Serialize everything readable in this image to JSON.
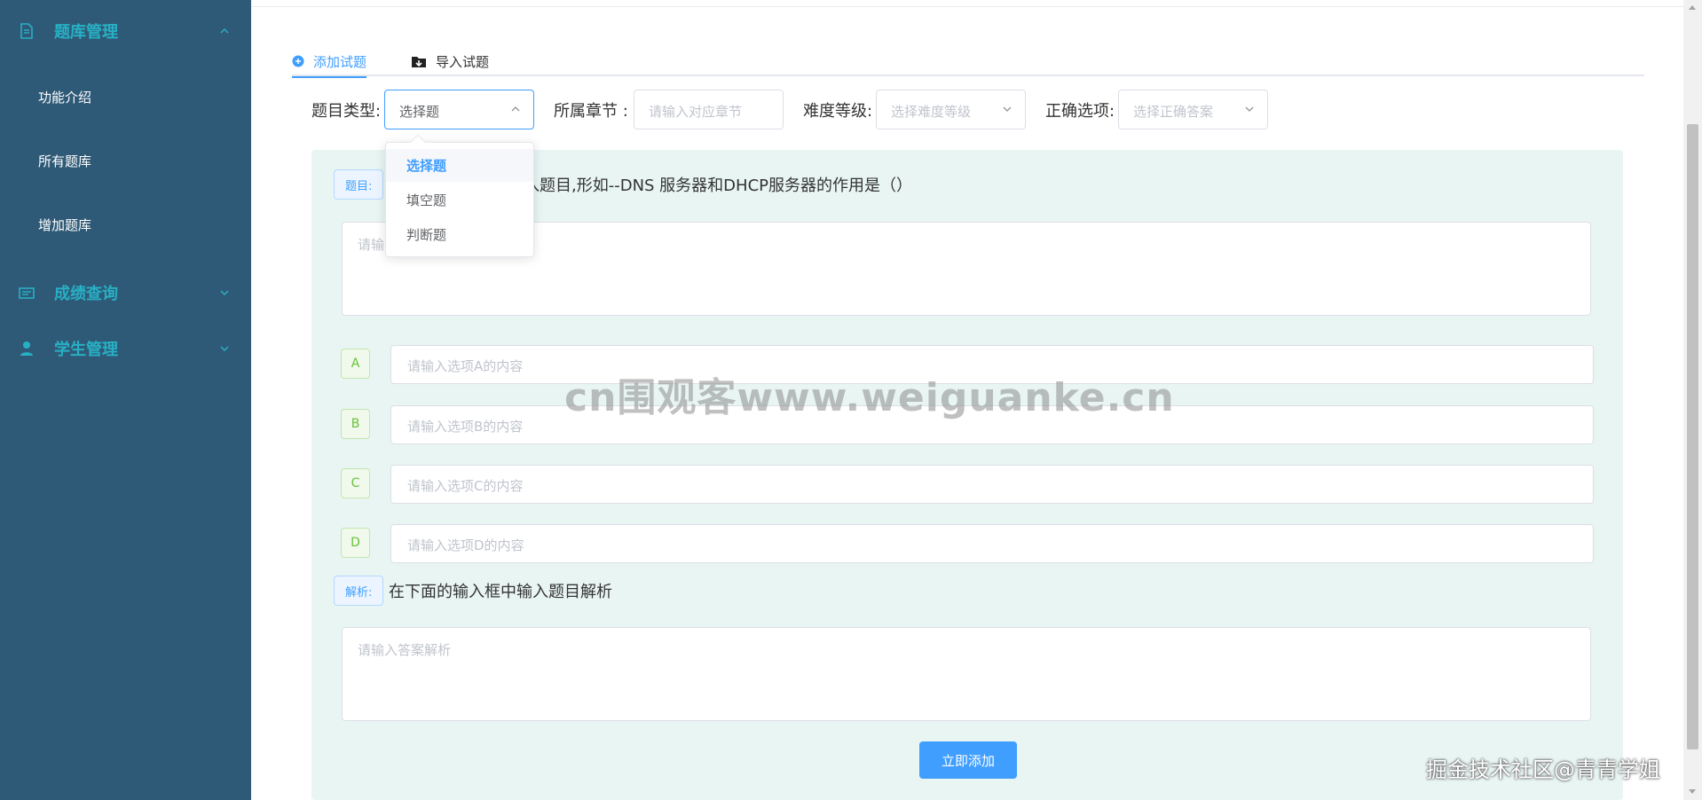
{
  "sidebar": {
    "groups": [
      {
        "label": "题库管理",
        "icon": "document-icon",
        "expanded": true
      },
      {
        "label": "成绩查询",
        "icon": "chart-icon",
        "expanded": false
      },
      {
        "label": "学生管理",
        "icon": "user-icon",
        "expanded": false
      }
    ],
    "sub_items": [
      "功能介绍",
      "所有题库",
      "增加题库"
    ],
    "colors": {
      "background": "#2f5a77",
      "group_text": "#27b0c4",
      "item_text": "#ffffff"
    }
  },
  "tabs": [
    {
      "label": "添加试题",
      "icon": "plus-circle-icon",
      "active": true
    },
    {
      "label": "导入试题",
      "icon": "folder-import-icon",
      "active": false
    }
  ],
  "filters": {
    "type": {
      "label": "题目类型:",
      "value": "选择题",
      "open": true
    },
    "chapter": {
      "label": "所属章节 :",
      "placeholder": "请输入对应章节"
    },
    "difficulty": {
      "label": "难度等级:",
      "placeholder": "选择难度等级"
    },
    "answer": {
      "label": "正确选项:",
      "placeholder": "选择正确答案"
    }
  },
  "dropdown": {
    "options": [
      "选择题",
      "填空题",
      "判断题"
    ],
    "selected_index": 0
  },
  "question": {
    "tag": "题目:",
    "hint": "入题目,形如--DNS 服务器和DHCP服务器的作用是（）",
    "placeholder": "请输"
  },
  "options": [
    {
      "letter": "A",
      "placeholder": "请输入选项A的内容"
    },
    {
      "letter": "B",
      "placeholder": "请输入选项B的内容"
    },
    {
      "letter": "C",
      "placeholder": "请输入选项C的内容"
    },
    {
      "letter": "D",
      "placeholder": "请输入选项D的内容"
    }
  ],
  "analysis": {
    "tag": "解析:",
    "hint": "在下面的输入框中输入题目解析",
    "placeholder": "请输入答案解析"
  },
  "submit_label": "立即添加",
  "watermarks": {
    "center": "cn围观客www.weiguanke.cn",
    "corner": "掘金技术社区@青青学姐"
  },
  "colors": {
    "accent": "#409eff",
    "panel_bg": "#e8f5f3",
    "letter_green": "#67c23a"
  }
}
